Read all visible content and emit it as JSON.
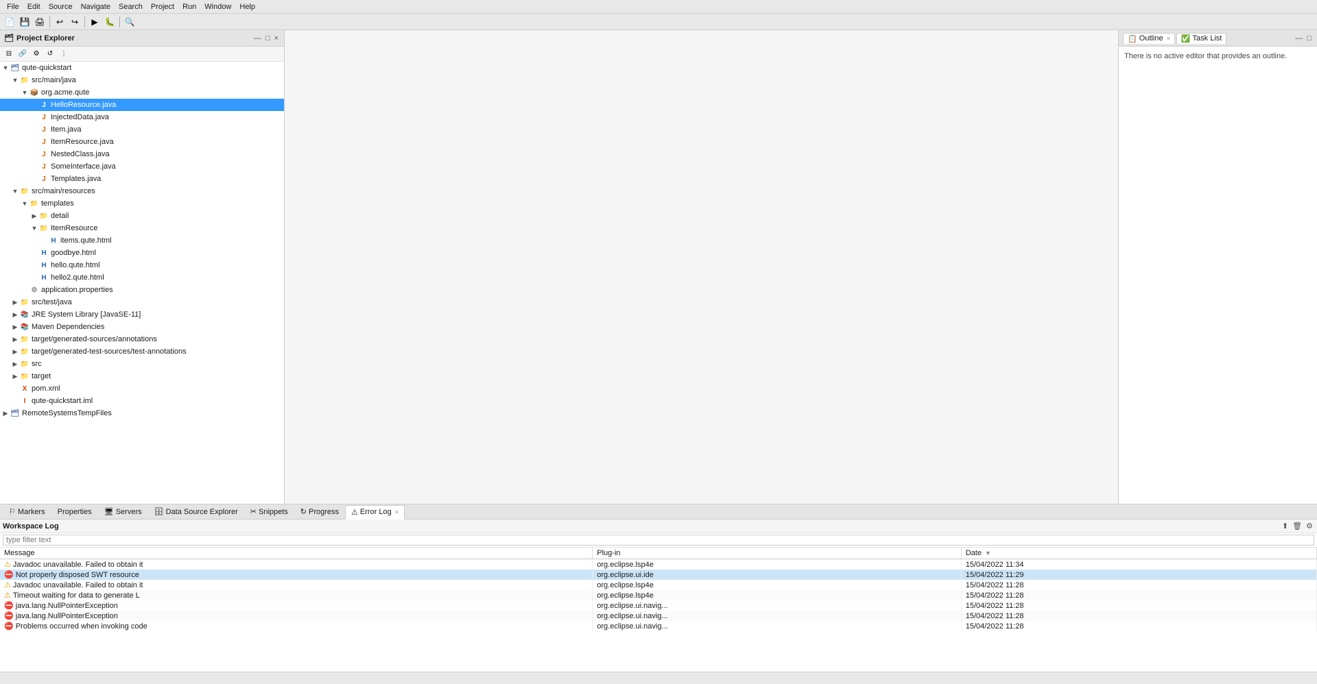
{
  "menuBar": {
    "items": [
      "File",
      "Edit",
      "Source",
      "Navigate",
      "Search",
      "Project",
      "Run",
      "Window",
      "Help"
    ]
  },
  "leftPanel": {
    "title": "Project Explorer",
    "closeLabel": "×"
  },
  "tree": {
    "items": [
      {
        "id": "qute-quickstart",
        "label": "qute-quickstart",
        "depth": 0,
        "arrow": "▼",
        "icon": "project",
        "iconChar": "🗂"
      },
      {
        "id": "src-main-java",
        "label": "src/main/java",
        "depth": 1,
        "arrow": "▼",
        "icon": "folder",
        "iconChar": "📁"
      },
      {
        "id": "org-acme-qute",
        "label": "org.acme.qute",
        "depth": 2,
        "arrow": "▼",
        "icon": "package",
        "iconChar": "📦"
      },
      {
        "id": "HelloResource",
        "label": "HelloResource.java",
        "depth": 3,
        "arrow": "",
        "icon": "java",
        "iconChar": "J",
        "selected": true
      },
      {
        "id": "InjectedData",
        "label": "InjectedData.java",
        "depth": 3,
        "arrow": "",
        "icon": "java",
        "iconChar": "J"
      },
      {
        "id": "Item",
        "label": "Item.java",
        "depth": 3,
        "arrow": "",
        "icon": "java",
        "iconChar": "J"
      },
      {
        "id": "ItemResource",
        "label": "ItemResource.java",
        "depth": 3,
        "arrow": "",
        "icon": "java",
        "iconChar": "J"
      },
      {
        "id": "NestedClass",
        "label": "NestedClass.java",
        "depth": 3,
        "arrow": "",
        "icon": "java",
        "iconChar": "J"
      },
      {
        "id": "SomeInterface",
        "label": "SomeInterface.java",
        "depth": 3,
        "arrow": "",
        "icon": "java",
        "iconChar": "J"
      },
      {
        "id": "Templates",
        "label": "Templates.java",
        "depth": 3,
        "arrow": "",
        "icon": "java",
        "iconChar": "J"
      },
      {
        "id": "src-main-resources",
        "label": "src/main/resources",
        "depth": 1,
        "arrow": "▼",
        "icon": "folder",
        "iconChar": "📁"
      },
      {
        "id": "templates",
        "label": "templates",
        "depth": 2,
        "arrow": "▼",
        "icon": "folder",
        "iconChar": "📁"
      },
      {
        "id": "detail",
        "label": "detail",
        "depth": 3,
        "arrow": "▶",
        "icon": "folder",
        "iconChar": "📁"
      },
      {
        "id": "ItemResource-folder",
        "label": "ItemResource",
        "depth": 3,
        "arrow": "▼",
        "icon": "folder",
        "iconChar": "📁"
      },
      {
        "id": "items-qute",
        "label": "items.qute.html",
        "depth": 4,
        "arrow": "",
        "icon": "html",
        "iconChar": "H"
      },
      {
        "id": "goodbye",
        "label": "goodbye.html",
        "depth": 3,
        "arrow": "",
        "icon": "html",
        "iconChar": "H"
      },
      {
        "id": "hello-qute",
        "label": "hello.qute.html",
        "depth": 3,
        "arrow": "",
        "icon": "html",
        "iconChar": "H"
      },
      {
        "id": "hello2-qute",
        "label": "hello2.qute.html",
        "depth": 3,
        "arrow": "",
        "icon": "html",
        "iconChar": "H"
      },
      {
        "id": "application-props",
        "label": "application.properties",
        "depth": 2,
        "arrow": "",
        "icon": "properties",
        "iconChar": "⚙"
      },
      {
        "id": "src-test-java",
        "label": "src/test/java",
        "depth": 1,
        "arrow": "▶",
        "icon": "folder",
        "iconChar": "📁"
      },
      {
        "id": "jre-system",
        "label": "JRE System Library [JavaSE-11]",
        "depth": 1,
        "arrow": "▶",
        "icon": "lib",
        "iconChar": "📚"
      },
      {
        "id": "maven-deps",
        "label": "Maven Dependencies",
        "depth": 1,
        "arrow": "▶",
        "icon": "lib",
        "iconChar": "📚"
      },
      {
        "id": "target-generated-sources",
        "label": "target/generated-sources/annotations",
        "depth": 1,
        "arrow": "▶",
        "icon": "folder",
        "iconChar": "📁"
      },
      {
        "id": "target-generated-test-sources",
        "label": "target/generated-test-sources/test-annotations",
        "depth": 1,
        "arrow": "▶",
        "icon": "folder",
        "iconChar": "📁"
      },
      {
        "id": "src",
        "label": "src",
        "depth": 1,
        "arrow": "▶",
        "icon": "folder",
        "iconChar": "📁"
      },
      {
        "id": "target",
        "label": "target",
        "depth": 1,
        "arrow": "▶",
        "icon": "folder",
        "iconChar": "📁"
      },
      {
        "id": "pom-xml",
        "label": "pom.xml",
        "depth": 1,
        "arrow": "",
        "icon": "xml",
        "iconChar": "X"
      },
      {
        "id": "qute-quickstart-iml",
        "label": "qute-quickstart.iml",
        "depth": 1,
        "arrow": "",
        "icon": "iml",
        "iconChar": "I"
      },
      {
        "id": "RemoteSystemsTempFiles",
        "label": "RemoteSystemsTempFiles",
        "depth": 0,
        "arrow": "▶",
        "icon": "project",
        "iconChar": "🗂"
      }
    ]
  },
  "outline": {
    "tabs": [
      "Outline",
      "Task List"
    ],
    "noEditorMessage": "There is no active editor that provides an outline."
  },
  "bottomTabs": {
    "tabs": [
      {
        "label": "Markers",
        "icon": "⚐",
        "active": false
      },
      {
        "label": "Properties",
        "icon": "",
        "active": false
      },
      {
        "label": "Servers",
        "icon": "🖥",
        "active": false
      },
      {
        "label": "Data Source Explorer",
        "icon": "🗄",
        "active": false
      },
      {
        "label": "Snippets",
        "icon": "✂",
        "active": false
      },
      {
        "label": "Progress",
        "icon": "↻",
        "active": false
      },
      {
        "label": "Error Log",
        "icon": "⚠",
        "active": true,
        "closeable": true
      }
    ]
  },
  "errorLog": {
    "title": "Workspace Log",
    "filterPlaceholder": "type filter text",
    "columns": [
      "Message",
      "Plug-in",
      "Date"
    ],
    "rows": [
      {
        "type": "warning",
        "message": "Javadoc unavailable. Failed to obtain it",
        "plugin": "org.eclipse.lsp4e",
        "date": "15/04/2022 11:34",
        "selected": false
      },
      {
        "type": "error",
        "message": "Not properly disposed SWT resource",
        "plugin": "org.eclipse.ui.ide",
        "date": "15/04/2022 11:29",
        "selected": true
      },
      {
        "type": "warning",
        "message": "Javadoc unavailable. Failed to obtain it",
        "plugin": "org.eclipse.lsp4e",
        "date": "15/04/2022 11:28",
        "selected": false
      },
      {
        "type": "warning",
        "message": "Timeout waiting for data to generate L",
        "plugin": "org.eclipse.lsp4e",
        "date": "15/04/2022 11:28",
        "selected": false
      },
      {
        "type": "error",
        "message": "java.lang.NullPointerException",
        "plugin": "org.eclipse.ui.navig...",
        "date": "15/04/2022 11:28",
        "selected": false
      },
      {
        "type": "error",
        "message": "java.lang.NullPointerException",
        "plugin": "org.eclipse.ui.navig...",
        "date": "15/04/2022 11:28",
        "selected": false
      },
      {
        "type": "error",
        "message": "Problems occurred when invoking code",
        "plugin": "org.eclipse.ui.navig...",
        "date": "15/04/2022 11:28",
        "selected": false
      }
    ]
  }
}
